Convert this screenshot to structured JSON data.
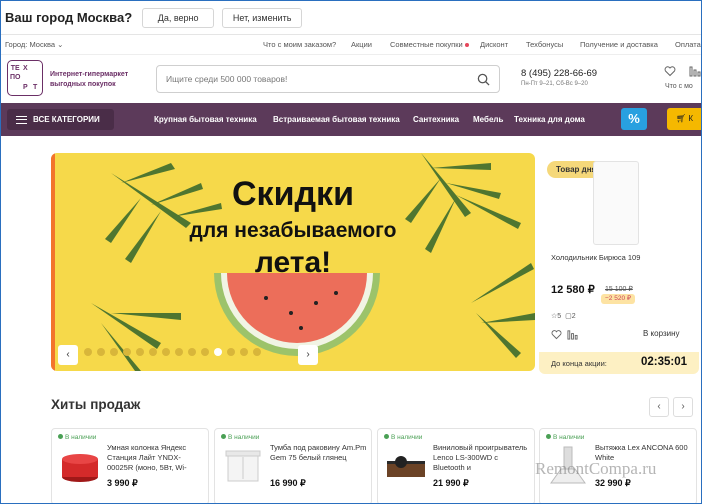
{
  "city_prompt": {
    "question": "Ваш город Москва?",
    "confirm_label": "Да, верно",
    "change_label": "Нет, изменить"
  },
  "top_links": {
    "city": "Город: Москва",
    "items": [
      "Что с моим заказом?",
      "Акции",
      "Совместные покупки",
      "Дисконт",
      "Техбонусы",
      "Получение и доставка",
      "Оплата"
    ]
  },
  "header": {
    "logo_letters": [
      "ТЕ",
      "Х",
      "",
      "ПО",
      "",
      "",
      "",
      "Р",
      "Т"
    ],
    "tagline": "Интернет-гипермаркет выгодных покупок",
    "search_placeholder": "Ищите среди 500 000 товаров!",
    "phone": "8 (495) 228-66-69",
    "hours": "Пн-Пт 9–21, Сб-Вс 9–20",
    "compare_label": "Что с мо"
  },
  "nav": {
    "all_categories": "ВСЕ КАТЕГОРИИ",
    "items": [
      "Крупная бытовая техника",
      "Встраиваемая бытовая техника",
      "Сантехника",
      "Мебель",
      "Техника для дома"
    ],
    "promo_icon": "%",
    "cart_label": "К"
  },
  "banner": {
    "line1": "Скидки",
    "line2": "для незабываемого",
    "line3": "лета!",
    "slide_count": 14,
    "active_slide": 10,
    "prev": "‹",
    "next": "›"
  },
  "product_of_day": {
    "tag": "Товар дня",
    "name": "Холодильник Бирюса 109",
    "price": "12 580 ₽",
    "old_price": "15 100 ₽",
    "discount": "−2 520 ₽",
    "rating": "5",
    "reviews": "2",
    "cart_label": "В корзину",
    "timer_label": "До конца акции:",
    "timer_value": "02:35:01"
  },
  "hits": {
    "title": "Хиты продаж",
    "prev": "‹",
    "next": "›",
    "products": [
      {
        "stock": "В наличии",
        "name": "Умная колонка Яндекс Станция Лайт YNDX-00025R (моно, 5Вт, Wi-",
        "price": "3 990 ₽"
      },
      {
        "stock": "В наличии",
        "name": "Тумба под раковину Am.Pm Gem 75 белый глянец",
        "price": "16 990 ₽"
      },
      {
        "stock": "В наличии",
        "name": "Виниловый проигрыватель Lenco LS-300WD с Bluetooth и",
        "price": "21 990 ₽"
      },
      {
        "stock": "В наличии",
        "name": "Вытяжка Lex ANCONA 600 White",
        "price": "32 990 ₽"
      }
    ]
  },
  "watermark": "RemontCompa.ru"
}
